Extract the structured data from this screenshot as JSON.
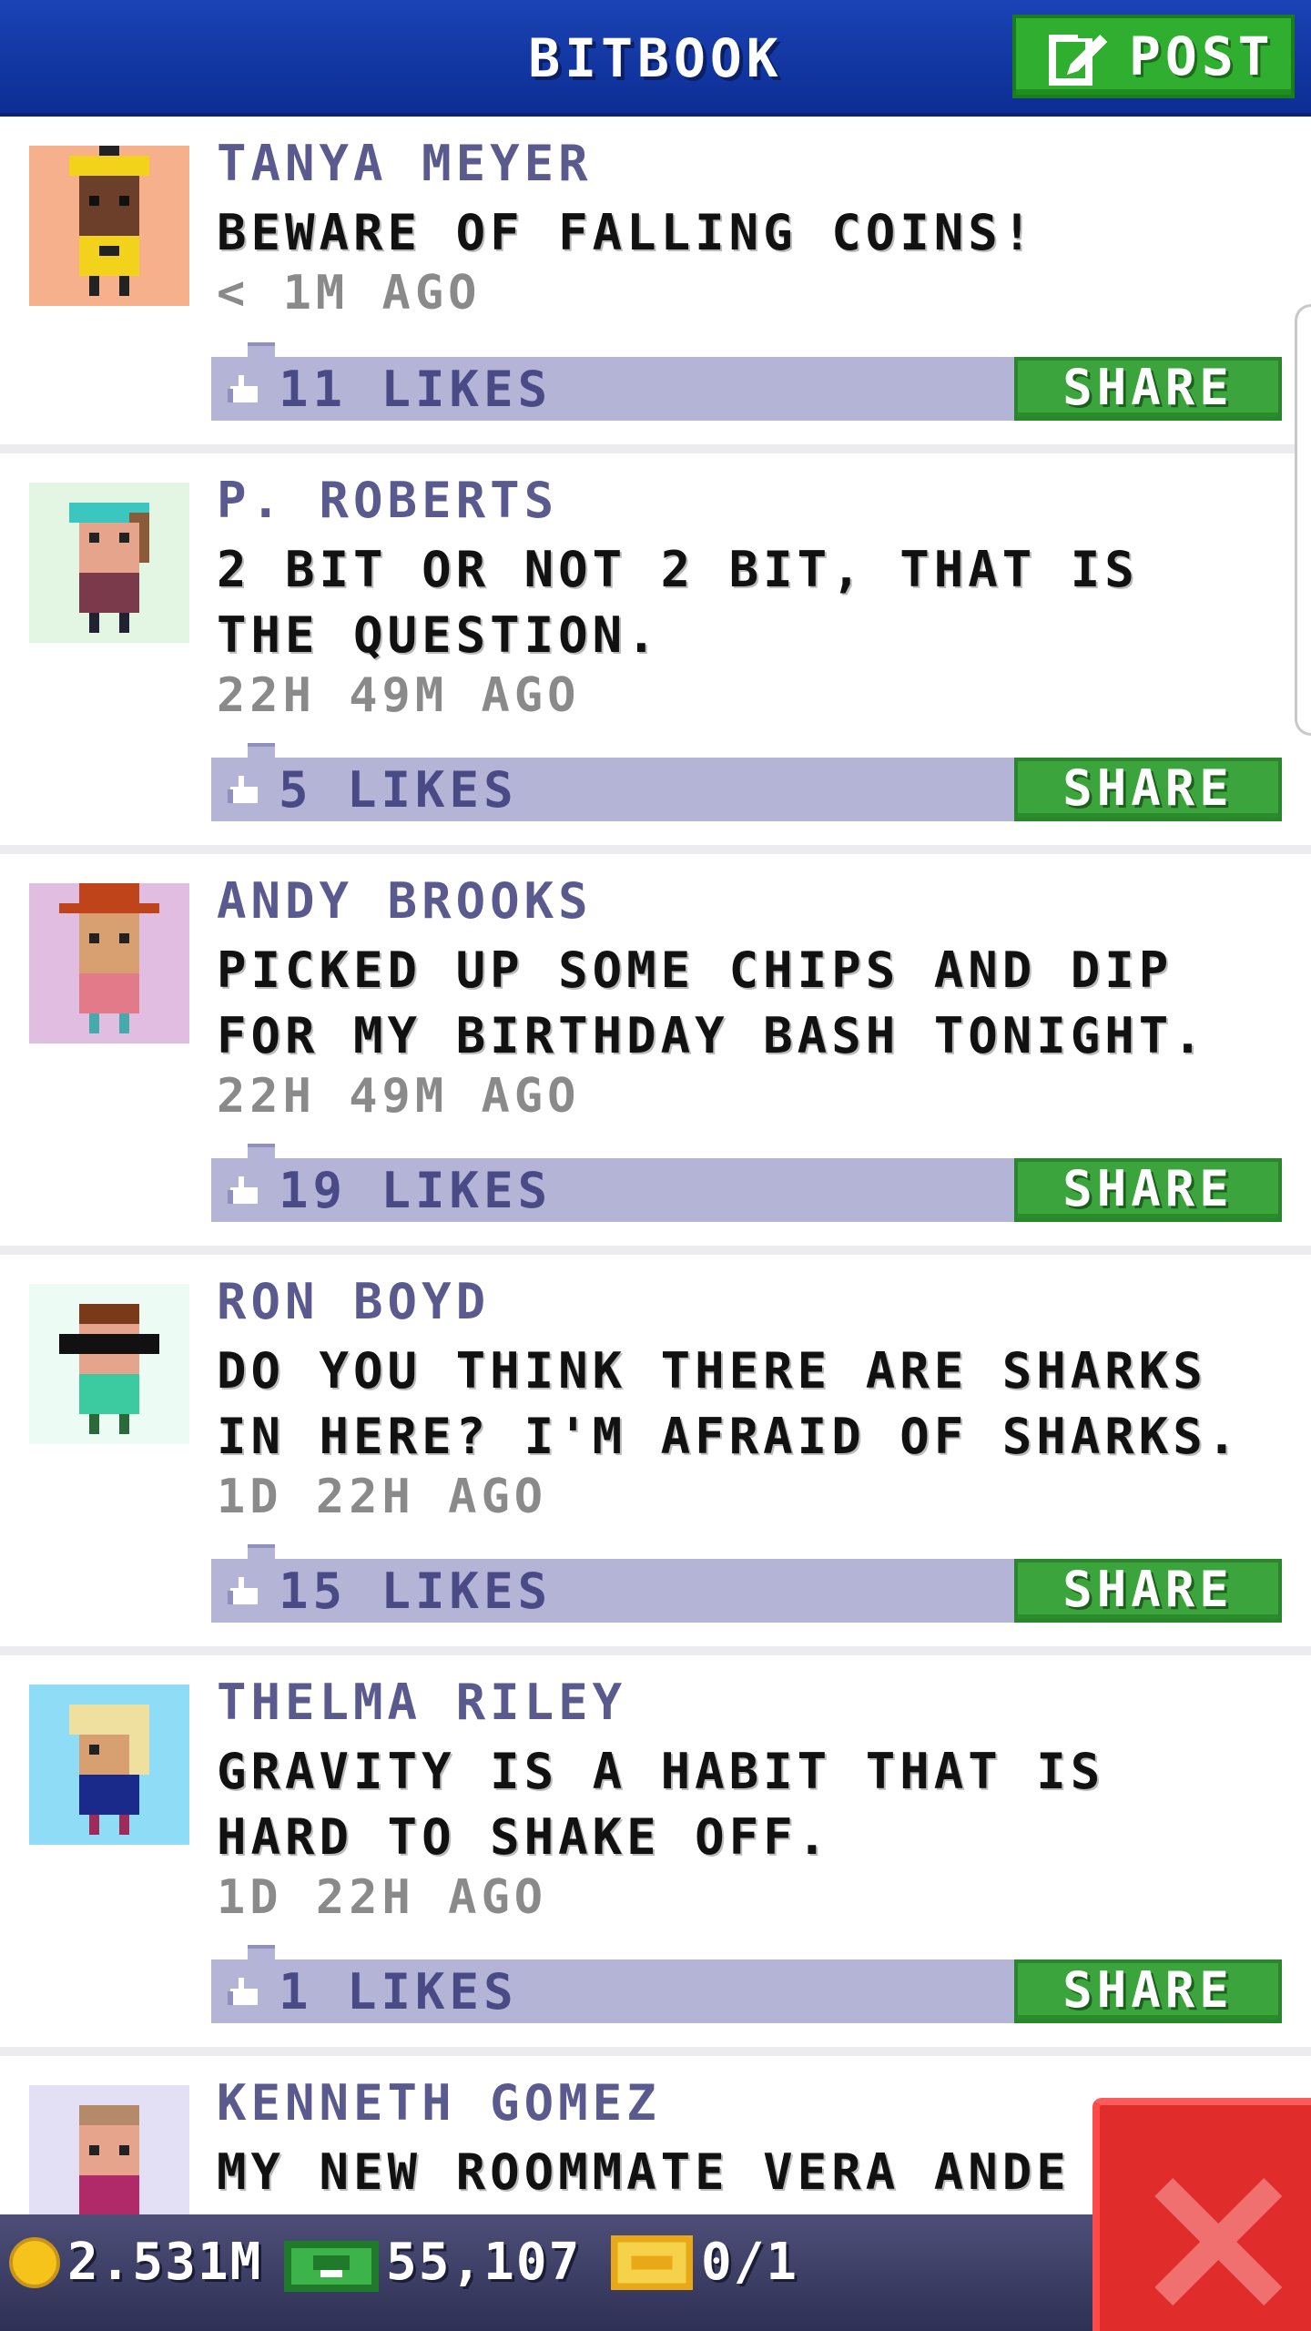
{
  "header": {
    "title": "BITBOOK",
    "post_label": "POST"
  },
  "posts": [
    {
      "name": "TANYA MEYER",
      "message": "BEWARE OF FALLING COINS!",
      "time": "< 1M AGO",
      "likes": "11 LIKES",
      "share": "SHARE",
      "avatar_bg": "#f7b08c"
    },
    {
      "name": "P. ROBERTS",
      "message": "2 BIT OR NOT 2 BIT, THAT IS THE QUESTION.",
      "time": "22H 49M AGO",
      "likes": "5 LIKES",
      "share": "SHARE",
      "avatar_bg": "#e3f6e4"
    },
    {
      "name": "ANDY BROOKS",
      "message": "PICKED UP SOME CHIPS AND DIP FOR MY BIRTHDAY BASH TONIGHT.",
      "time": "22H 49M AGO",
      "likes": "19 LIKES",
      "share": "SHARE",
      "avatar_bg": "#e2bde2"
    },
    {
      "name": "RON BOYD",
      "message": "DO YOU THINK THERE ARE SHARKS IN HERE? I'M AFRAID OF SHARKS.",
      "time": "1D 22H AGO",
      "likes": "15 LIKES",
      "share": "SHARE",
      "avatar_bg": "#ecfbf4"
    },
    {
      "name": "THELMA RILEY",
      "message": "GRAVITY IS A HABIT THAT IS HARD TO SHAKE OFF.",
      "time": "1D 22H AGO",
      "likes": "1 LIKES",
      "share": "SHARE",
      "avatar_bg": "#8edcf6"
    },
    {
      "name": "KENNETH GOMEZ",
      "message": "MY NEW ROOMMATE VERA ANDE",
      "avatar_bg": "#e3dff4"
    }
  ],
  "status": {
    "coins": "2.531M",
    "cash": "55,107",
    "tickets": "0/1"
  },
  "icons": {
    "post": "edit-icon",
    "like": "thumbs-up-icon",
    "coins": "coin-icon",
    "cash": "cash-icon",
    "tickets": "ticket-icon",
    "close": "close-icon"
  },
  "colors": {
    "header": "#1b43b6",
    "accent_green": "#3ca43c",
    "likebar": "#b3b4d6",
    "close": "#e12c2c"
  }
}
